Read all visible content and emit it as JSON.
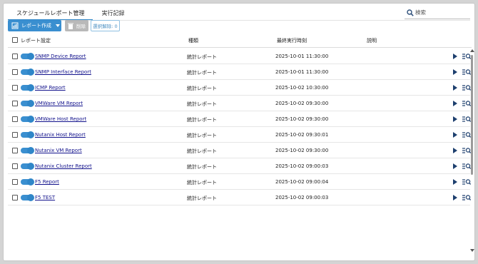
{
  "tabs": [
    {
      "label": "スケジュールレポート管理",
      "active": true
    },
    {
      "label": "実行記録",
      "active": false
    }
  ],
  "search": {
    "placeholder": "検索",
    "value": ""
  },
  "toolbar": {
    "create_label": "レポート作成",
    "delete_label": "削除",
    "clear_label": "選択解除: 0"
  },
  "columns": {
    "settings": "レポート設定",
    "type": "種類",
    "last_run": "最終実行時刻",
    "description": "説明"
  },
  "rows": [
    {
      "name": "SNMP Device Report",
      "type": "統計レポート",
      "last_run": "2025-10-01 11:30:00",
      "description": "",
      "enabled": true
    },
    {
      "name": "SNMP Interface Report",
      "type": "統計レポート",
      "last_run": "2025-10-01 11:30:00",
      "description": "",
      "enabled": true
    },
    {
      "name": "ICMP Report",
      "type": "統計レポート",
      "last_run": "2025-10-02 10:30:00",
      "description": "",
      "enabled": true
    },
    {
      "name": "VMWare VM Report",
      "type": "統計レポート",
      "last_run": "2025-10-02 09:30:00",
      "description": "",
      "enabled": true
    },
    {
      "name": "VMWare Host Report",
      "type": "統計レポート",
      "last_run": "2025-10-02 09:30:00",
      "description": "",
      "enabled": true
    },
    {
      "name": "Nutanix Host Report",
      "type": "統計レポート",
      "last_run": "2025-10-02 09:30:01",
      "description": "",
      "enabled": true
    },
    {
      "name": "Nutanix VM Report",
      "type": "統計レポート",
      "last_run": "2025-10-02 09:30:00",
      "description": "",
      "enabled": true
    },
    {
      "name": "Nutanix Cluster Report",
      "type": "統計レポート",
      "last_run": "2025-10-02 09:00:03",
      "description": "",
      "enabled": true
    },
    {
      "name": "F5 Report",
      "type": "統計レポート",
      "last_run": "2025-10-02 09:00:04",
      "description": "",
      "enabled": true
    },
    {
      "name": "F5 TEST",
      "type": "統計レポート",
      "last_run": "2025-10-02 09:00:03",
      "description": "",
      "enabled": true
    }
  ],
  "colors": {
    "accent": "#3a8fd0",
    "link": "#12128c",
    "action_icon": "#1d3f6e"
  },
  "icons": {
    "search": "search-icon",
    "create": "report-add-icon",
    "delete": "trash-icon",
    "run": "play-icon",
    "detail": "list-search-icon"
  }
}
